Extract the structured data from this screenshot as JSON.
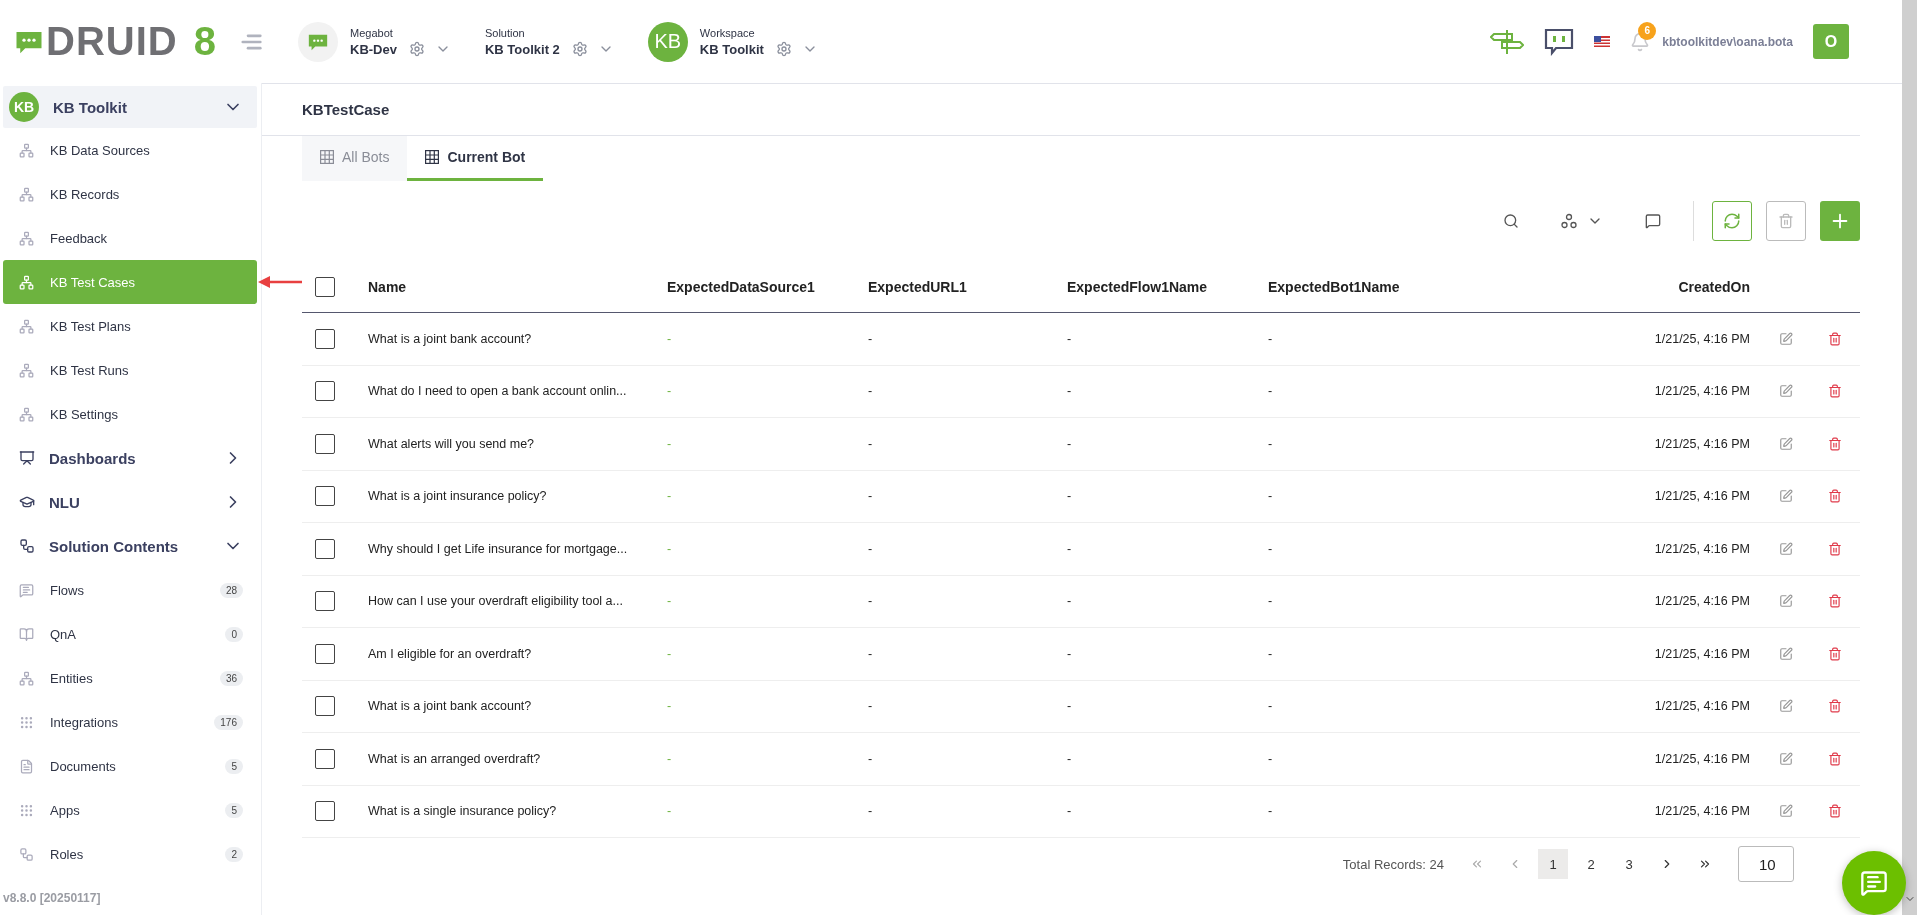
{
  "logo": {
    "text": "DRUID",
    "version": "8"
  },
  "selectors": [
    {
      "label": "Megabot",
      "value": "KB-Dev",
      "kind": "logo"
    },
    {
      "label": "Solution",
      "value": "KB Toolkit 2",
      "kind": "plain"
    },
    {
      "label": "Workspace",
      "value": "KB Toolkit",
      "kind": "initials",
      "initials": "KB"
    }
  ],
  "user": {
    "notifications": "6",
    "name": "kbtoolkitdev\\oana.bota",
    "initial": "O"
  },
  "sidebar": {
    "groups": [
      {
        "label": "KB Toolkit",
        "initials": "KB",
        "expanded": true,
        "children": [
          {
            "label": "KB Data Sources",
            "selected": false
          },
          {
            "label": "KB Records",
            "selected": false
          },
          {
            "label": "Feedback",
            "selected": false
          },
          {
            "label": "KB Test Cases",
            "selected": true
          },
          {
            "label": "KB Test Plans",
            "selected": false
          },
          {
            "label": "KB Test Runs",
            "selected": false
          },
          {
            "label": "KB Settings",
            "selected": false
          }
        ]
      },
      {
        "label": "Dashboards",
        "expanded": false
      },
      {
        "label": "NLU",
        "expanded": false
      },
      {
        "label": "Solution Contents",
        "expanded": true,
        "children": [
          {
            "label": "Flows",
            "count": "28",
            "selected": false
          },
          {
            "label": "QnA",
            "count": "0",
            "selected": false
          },
          {
            "label": "Entities",
            "count": "36",
            "selected": false
          },
          {
            "label": "Integrations",
            "count": "176",
            "selected": false
          },
          {
            "label": "Documents",
            "count": "5",
            "selected": false
          },
          {
            "label": "Apps",
            "count": "5",
            "selected": false
          },
          {
            "label": "Roles",
            "count": "2",
            "selected": false
          }
        ]
      }
    ],
    "version": "v8.8.0 [20250117]"
  },
  "page_title": "KBTestCase",
  "tabs": [
    {
      "label": "All Bots",
      "selected": false
    },
    {
      "label": "Current Bot",
      "selected": true
    }
  ],
  "table": {
    "columns": [
      "Name",
      "ExpectedDataSource1",
      "ExpectedURL1",
      "ExpectedFlow1Name",
      "ExpectedBot1Name",
      "CreatedOn"
    ],
    "header_checked": false,
    "rows": [
      {
        "checked": false,
        "cells": [
          "What is a joint bank account?",
          "-",
          "-",
          "-",
          "-",
          "1/21/25, 4:16 PM"
        ]
      },
      {
        "checked": false,
        "cells": [
          "What do I need to open a bank account onlin...",
          "-",
          "-",
          "-",
          "-",
          "1/21/25, 4:16 PM"
        ]
      },
      {
        "checked": false,
        "cells": [
          "What alerts will you send me?",
          "-",
          "-",
          "-",
          "-",
          "1/21/25, 4:16 PM"
        ]
      },
      {
        "checked": false,
        "cells": [
          "What is a joint insurance policy?",
          "-",
          "-",
          "-",
          "-",
          "1/21/25, 4:16 PM"
        ]
      },
      {
        "checked": false,
        "cells": [
          "Why should I get Life insurance for mortgage...",
          "-",
          "-",
          "-",
          "-",
          "1/21/25, 4:16 PM"
        ]
      },
      {
        "checked": false,
        "cells": [
          "How can I use your overdraft eligibility tool a...",
          "-",
          "-",
          "-",
          "-",
          "1/21/25, 4:16 PM"
        ]
      },
      {
        "checked": false,
        "cells": [
          "Am I eligible for an overdraft?",
          "-",
          "-",
          "-",
          "-",
          "1/21/25, 4:16 PM"
        ]
      },
      {
        "checked": false,
        "cells": [
          "What is a joint bank account?",
          "-",
          "-",
          "-",
          "-",
          "1/21/25, 4:16 PM"
        ]
      },
      {
        "checked": false,
        "cells": [
          "What is an arranged overdraft?",
          "-",
          "-",
          "-",
          "-",
          "1/21/25, 4:16 PM"
        ]
      },
      {
        "checked": false,
        "cells": [
          "What is a single insurance policy?",
          "-",
          "-",
          "-",
          "-",
          "1/21/25, 4:16 PM"
        ]
      }
    ]
  },
  "pagination": {
    "total": "Total Records: 24",
    "pages": [
      {
        "label": "1",
        "selected": true
      },
      {
        "label": "2",
        "selected": false
      },
      {
        "label": "3",
        "selected": false
      }
    ],
    "page_size": "10"
  }
}
